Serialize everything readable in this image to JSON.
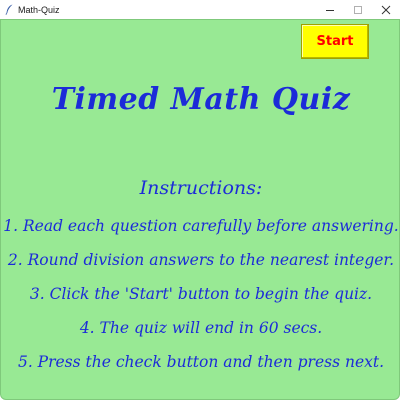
{
  "window": {
    "title": "Math-Quiz",
    "icon": "feather-icon"
  },
  "controls": {
    "minimize": "minimize-icon",
    "maximize": "maximize-icon",
    "close": "close-icon"
  },
  "toolbar": {
    "start_label": "Start"
  },
  "main": {
    "heading": "Timed Math Quiz",
    "instructions_title": "Instructions:",
    "instructions": [
      "1. Read each question carefully before answering.",
      "2. Round division answers to the nearest integer.",
      "3. Click the 'Start' button to begin the quiz.",
      "4. The quiz will end in 60 secs.",
      "5. Press the check button and then press next."
    ]
  },
  "colors": {
    "background": "#98e994",
    "text": "#1c2bd8",
    "start_button_bg": "#ffff00",
    "start_button_text": "#ff0000"
  }
}
